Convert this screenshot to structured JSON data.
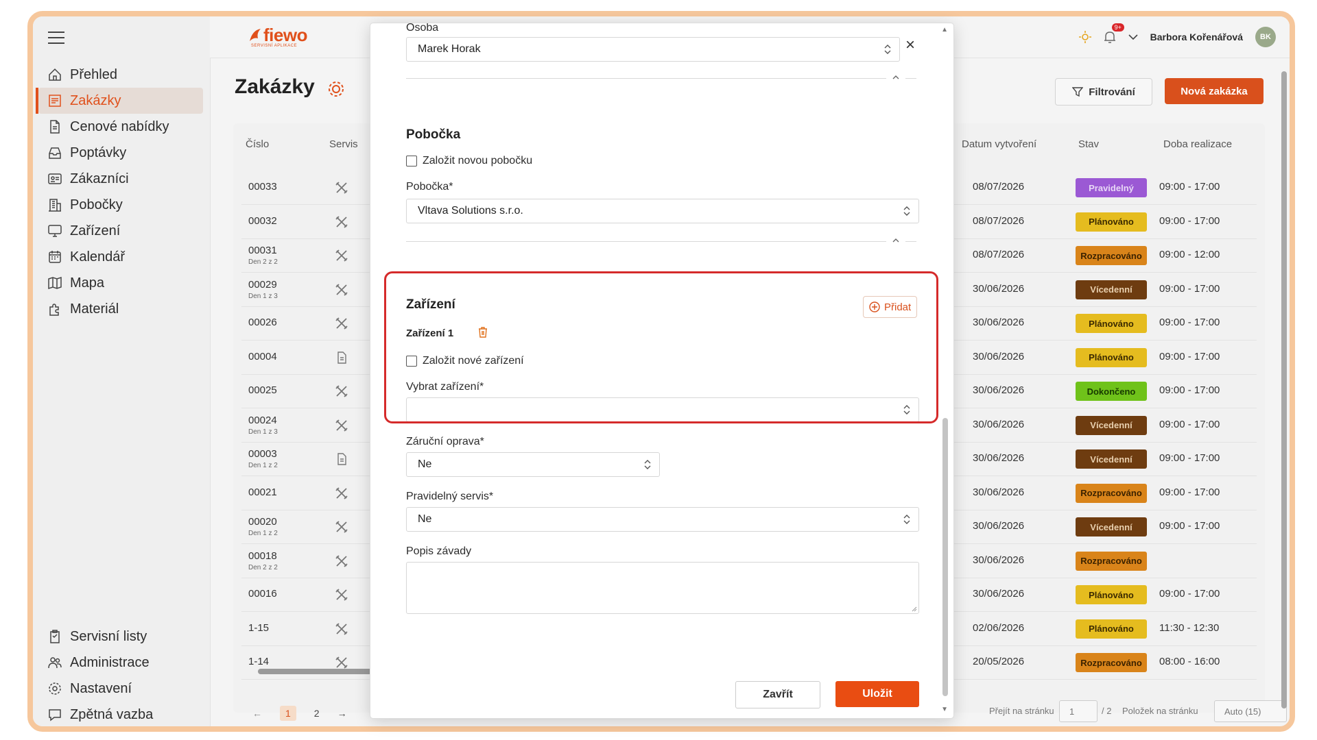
{
  "app": {
    "logo_text": "fiewo",
    "logo_sub": "SERVISNÍ APLIKACE",
    "user_name": "Barbora Kořenářová",
    "avatar_initials": "BK",
    "notification_badge": "9+",
    "accent_color": "#e0501b"
  },
  "sidebar": {
    "items": [
      {
        "label": "Přehled",
        "icon": "home-icon"
      },
      {
        "label": "Zakázky",
        "icon": "orders-icon",
        "active": true
      },
      {
        "label": "Cenové nabídky",
        "icon": "document-icon"
      },
      {
        "label": "Poptávky",
        "icon": "inbox-icon"
      },
      {
        "label": "Zákazníci",
        "icon": "contacts-icon"
      },
      {
        "label": "Pobočky",
        "icon": "building-icon"
      },
      {
        "label": "Zařízení",
        "icon": "monitor-icon"
      },
      {
        "label": "Kalendář",
        "icon": "calendar-icon"
      },
      {
        "label": "Mapa",
        "icon": "map-icon"
      },
      {
        "label": "Materiál",
        "icon": "puzzle-icon"
      }
    ],
    "bottom_items": [
      {
        "label": "Servisní listy",
        "icon": "clipboard-icon"
      },
      {
        "label": "Administrace",
        "icon": "users-icon"
      },
      {
        "label": "Nastavení",
        "icon": "gear-icon"
      },
      {
        "label": "Zpětná vazba",
        "icon": "feedback-icon"
      }
    ]
  },
  "page": {
    "title": "Zakázky",
    "filter_label": "Filtrování",
    "new_label": "Nová zakázka"
  },
  "table": {
    "headers": {
      "cislo": "Číslo",
      "servis": "Servis",
      "datum": "Datum vytvoření",
      "stav": "Stav",
      "doba": "Doba realizace"
    },
    "rows": [
      {
        "num": "00033",
        "sub": "",
        "icon": "tools-icon",
        "date": "08/07/2026",
        "status": "Pravidelný",
        "status_color": "#9b59d4",
        "status_text_color": "#e8d8f6",
        "time": "09:00 - 17:00"
      },
      {
        "num": "00032",
        "sub": "",
        "icon": "tools-icon",
        "date": "08/07/2026",
        "status": "Plánováno",
        "status_color": "#e5bc1f",
        "status_text_color": "#3b2a00",
        "time": "09:00 - 17:00"
      },
      {
        "num": "00031",
        "sub": "Den 2 z 2",
        "icon": "tools-icon",
        "date": "08/07/2026",
        "status": "Rozpracováno",
        "status_color": "#d9841a",
        "status_text_color": "#3b2200",
        "time": "09:00 - 12:00"
      },
      {
        "num": "00029",
        "sub": "Den 1 z 3",
        "icon": "tools-icon",
        "date": "30/06/2026",
        "status": "Vícedenní",
        "status_color": "#6e3c10",
        "status_text_color": "#e8cfae",
        "time": "09:00 - 17:00"
      },
      {
        "num": "00026",
        "sub": "",
        "icon": "tools-icon",
        "date": "30/06/2026",
        "status": "Plánováno",
        "status_color": "#e5bc1f",
        "status_text_color": "#3b2a00",
        "time": "09:00 - 17:00"
      },
      {
        "num": "00004",
        "sub": "",
        "icon": "file-icon",
        "date": "30/06/2026",
        "status": "Plánováno",
        "status_color": "#e5bc1f",
        "status_text_color": "#3b2a00",
        "time": "09:00 - 17:00"
      },
      {
        "num": "00025",
        "sub": "",
        "icon": "tools-icon",
        "date": "30/06/2026",
        "status": "Dokončeno",
        "status_color": "#6fc21a",
        "status_text_color": "#163800",
        "time": "09:00 - 17:00"
      },
      {
        "num": "00024",
        "sub": "Den 1 z 3",
        "icon": "tools-icon",
        "date": "30/06/2026",
        "status": "Vícedenní",
        "status_color": "#6e3c10",
        "status_text_color": "#e8cfae",
        "time": "09:00 - 17:00"
      },
      {
        "num": "00003",
        "sub": "Den 1 z 2",
        "icon": "file-icon",
        "date": "30/06/2026",
        "status": "Vícedenní",
        "status_color": "#6e3c10",
        "status_text_color": "#e8cfae",
        "time": "09:00 - 17:00"
      },
      {
        "num": "00021",
        "sub": "",
        "icon": "tools-icon",
        "date": "30/06/2026",
        "status": "Rozpracováno",
        "status_color": "#d9841a",
        "status_text_color": "#3b2200",
        "time": "09:00 - 17:00"
      },
      {
        "num": "00020",
        "sub": "Den 1 z 2",
        "icon": "tools-icon",
        "date": "30/06/2026",
        "status": "Vícedenní",
        "status_color": "#6e3c10",
        "status_text_color": "#e8cfae",
        "time": "09:00 - 17:00"
      },
      {
        "num": "00018",
        "sub": "Den 2 z 2",
        "icon": "tools-icon",
        "date": "30/06/2026",
        "status": "Rozpracováno",
        "status_color": "#d9841a",
        "status_text_color": "#3b2200",
        "time": ""
      },
      {
        "num": "00016",
        "sub": "",
        "icon": "tools-icon",
        "date": "30/06/2026",
        "status": "Plánováno",
        "status_color": "#e5bc1f",
        "status_text_color": "#3b2a00",
        "time": "09:00 - 17:00"
      },
      {
        "num": "1-15",
        "sub": "",
        "icon": "tools-icon",
        "date": "02/06/2026",
        "status": "Plánováno",
        "status_color": "#e5bc1f",
        "status_text_color": "#3b2a00",
        "time": "11:30 - 12:30"
      },
      {
        "num": "1-14",
        "sub": "",
        "icon": "tools-icon",
        "date": "20/05/2026",
        "status": "Rozpracováno",
        "status_color": "#d9841a",
        "status_text_color": "#3b2200",
        "time": "08:00 - 16:00"
      }
    ],
    "pager": {
      "prev": "←",
      "page1": "1",
      "page2": "2",
      "next": "→",
      "goto_label": "Přejít na stránku",
      "goto_value": "1",
      "goto_total": "/ 2",
      "per_page_label": "Položek na stránku",
      "per_page_value": "Auto (15)"
    }
  },
  "modal": {
    "osoba_label": "Osoba",
    "osoba_value": "Marek Horak",
    "clear": "×",
    "pobocka_section": "Pobočka",
    "new_branch_label": "Založit novou pobočku",
    "pobocka_label": "Pobočka*",
    "pobocka_value": "Vltava Solutions s.r.o.",
    "zarizeni_section": "Zařízení",
    "add_label": "Přidat",
    "zarizeni_item": "Zařízení 1",
    "new_device_label": "Založit nové zařízení",
    "select_device_label": "Vybrat zařízení*",
    "select_device_value": "",
    "warranty_label": "Záruční oprava*",
    "warranty_value": "Ne",
    "regular_label": "Pravidelný servis*",
    "regular_value": "Ne",
    "fault_label": "Popis závady",
    "close_label": "Zavřít",
    "save_label": "Uložit"
  }
}
